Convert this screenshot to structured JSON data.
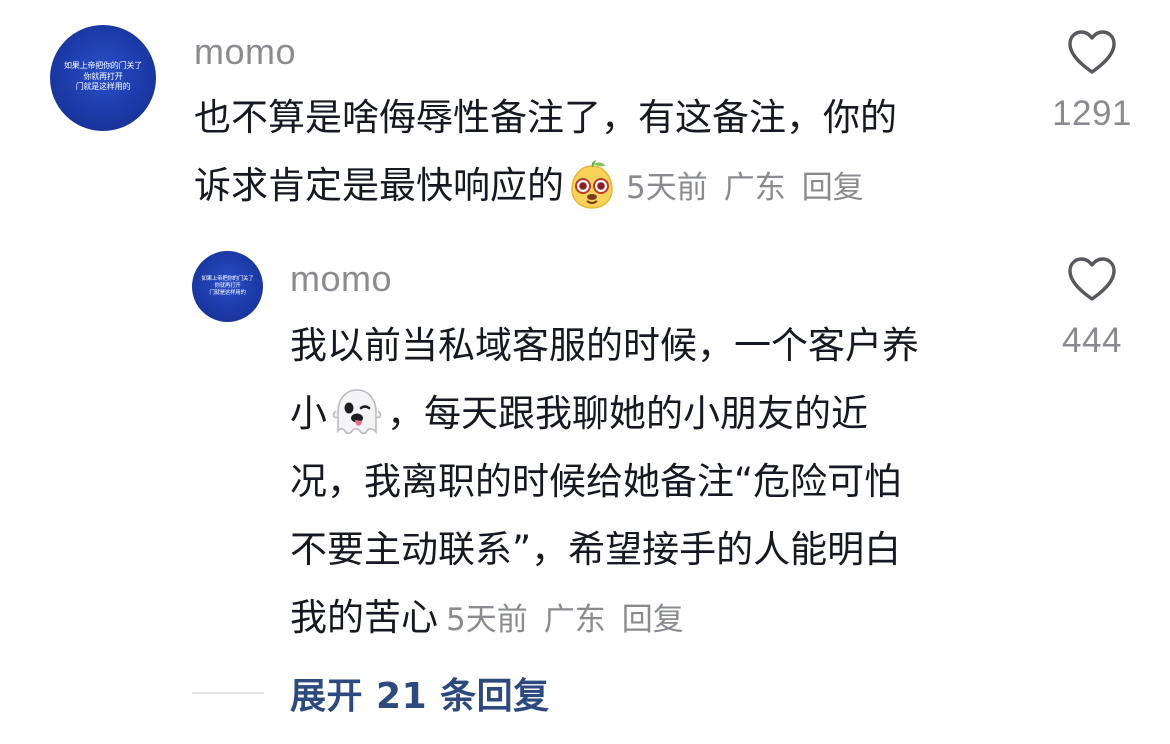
{
  "comments": [
    {
      "avatar_text": "如果上帝把你的门关了\n你就再打开\n门就是这样用的",
      "username": "momo",
      "lines": [
        "也不算是啥侮辱性备注了，有这备注，你的",
        "诉求肯定是最快响应的"
      ],
      "emoji": "happy-pear-emoji",
      "meta": {
        "time": "5天前",
        "location": "广东",
        "reply": "回复"
      },
      "likes": "1291"
    }
  ],
  "reply": {
    "avatar_text": "如果上帝把你的门关了\n你就再打开\n门就是这样用的",
    "username": "momo",
    "line1": "我以前当私域客服的时候，一个客户养",
    "line2_before": "小",
    "line2_after": "，每天跟我聊她的小朋友的近",
    "line3": "况，我离职的时候给她备注“危险可怕",
    "line4": "不要主动联系”，希望接手的人能明白",
    "line5": "我的苦心",
    "emoji": "ghost-emoji",
    "meta": {
      "time": "5天前",
      "location": "广东",
      "reply": "回复"
    },
    "likes": "444"
  },
  "expand": {
    "label": "展开 21 条回复"
  },
  "icons": {
    "like": "heart-outline-icon"
  },
  "colors": {
    "text": "#161823",
    "muted": "#8a8b91",
    "link": "#2c4a7e",
    "avatar": "#1c3aa8"
  }
}
